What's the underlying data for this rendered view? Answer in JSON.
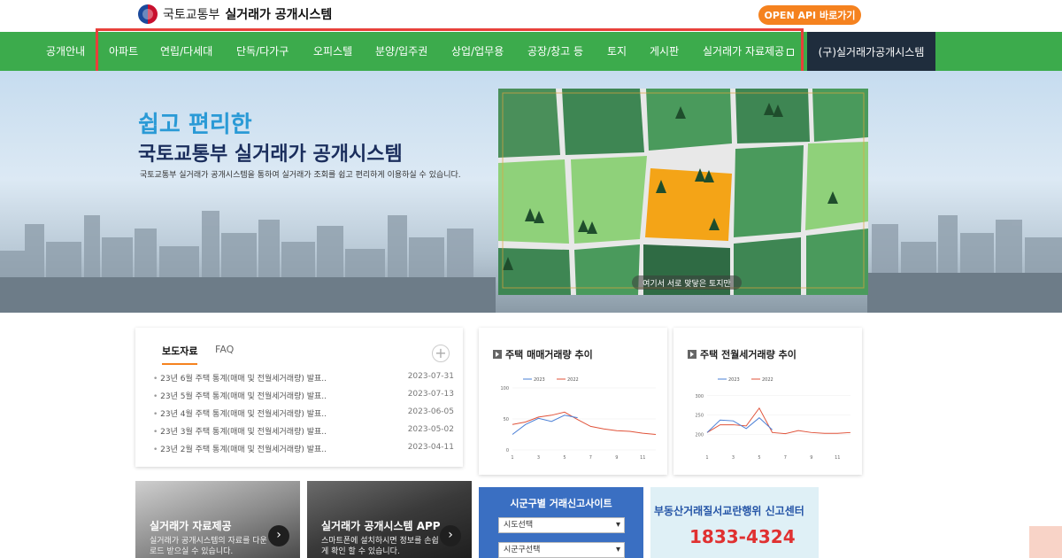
{
  "header": {
    "org_name": "국토교통부",
    "system_name": "실거래가 공개시스템",
    "api_button": "OPEN API 바로가기"
  },
  "nav": {
    "items": [
      {
        "label": "공개안내"
      },
      {
        "label": "아파트"
      },
      {
        "label": "연립/다세대"
      },
      {
        "label": "단독/다가구"
      },
      {
        "label": "오피스텔"
      },
      {
        "label": "분양/입주권"
      },
      {
        "label": "상업/업무용"
      },
      {
        "label": "공장/창고 등"
      },
      {
        "label": "토지"
      },
      {
        "label": "게시판"
      },
      {
        "label": "실거래가 자료제공"
      }
    ],
    "old_system": "(구)실거래가공개시스템"
  },
  "hero": {
    "title_line1": "쉽고 편리한",
    "title_line2": "국토교통부 실거래가 공개시스템",
    "description": "국토교통부 실거래가 공개시스템을 통하여 실거래가 조회를 쉽고 편리하게 이용하실 수 있습니다.",
    "map_caption": "여기서 서로 맞닿은 토지만"
  },
  "news": {
    "tabs": [
      "보도자료",
      "FAQ"
    ],
    "more": "+",
    "items": [
      {
        "title": "23년 6월 주택 통계(매매 및 전월세거래량) 발표..",
        "date": "2023-07-31"
      },
      {
        "title": "23년 5월 주택 통계(매매 및 전월세거래량) 발표..",
        "date": "2023-07-13"
      },
      {
        "title": "23년 4월 주택 통계(매매 및 전월세거래량) 발표..",
        "date": "2023-06-05"
      },
      {
        "title": "23년 3월 주택 통계(매매 및 전월세거래량) 발표..",
        "date": "2023-05-02"
      },
      {
        "title": "23년 2월 주택 통계(매매 및 전월세거래량) 발표..",
        "date": "2023-04-11"
      }
    ]
  },
  "chart_data": [
    {
      "type": "line",
      "title": "주택 매매거래량 추이",
      "x": [
        1,
        2,
        3,
        4,
        5,
        6,
        7,
        8,
        9,
        10,
        11,
        12
      ],
      "xticks": [
        "1",
        "3",
        "5",
        "7",
        "9",
        "11"
      ],
      "yticks": [
        "0",
        "50",
        "100"
      ],
      "ylim": [
        0,
        100
      ],
      "series": [
        {
          "name": "2023",
          "color": "#4a7fd6",
          "values": [
            25,
            41,
            51,
            46,
            56,
            52
          ]
        },
        {
          "name": "2022",
          "color": "#e0533a",
          "values": [
            41,
            45,
            53,
            56,
            61,
            49,
            38,
            34,
            31,
            30,
            27,
            25
          ]
        }
      ]
    },
    {
      "type": "line",
      "title": "주택 전월세거래량 추이",
      "x": [
        1,
        2,
        3,
        4,
        5,
        6,
        7,
        8,
        9,
        10,
        11,
        12
      ],
      "xticks": [
        "1",
        "3",
        "5",
        "7",
        "9",
        "11"
      ],
      "yticks": [
        "200",
        "250",
        "300"
      ],
      "ylim": [
        160,
        320
      ],
      "series": [
        {
          "name": "2023",
          "color": "#4a7fd6",
          "values": [
            205,
            237,
            235,
            215,
            243,
            212
          ]
        },
        {
          "name": "2022",
          "color": "#e0533a",
          "values": [
            205,
            225,
            225,
            222,
            268,
            205,
            202,
            210,
            205,
            203,
            203,
            205
          ]
        }
      ]
    }
  ],
  "tiles": [
    {
      "title": "실거래가 자료제공",
      "sub": "실거래가 공개시스템의 자료를 다운로드 받으실 수 있습니다.",
      "arrow": "›"
    },
    {
      "title": "실거래가 공개시스템 APP",
      "sub": "스마트폰에 설치하시면 정보를 손쉽게 확인 할 수 있습니다.",
      "arrow": "›"
    }
  ],
  "site_search": {
    "title": "시군구별 거래신고사이트",
    "sido_select": "시도선택",
    "sigungu_select": "시군구선택"
  },
  "report_center": {
    "title": "부동산거래질서교란행위 신고센터",
    "phone": "1833-4324"
  }
}
